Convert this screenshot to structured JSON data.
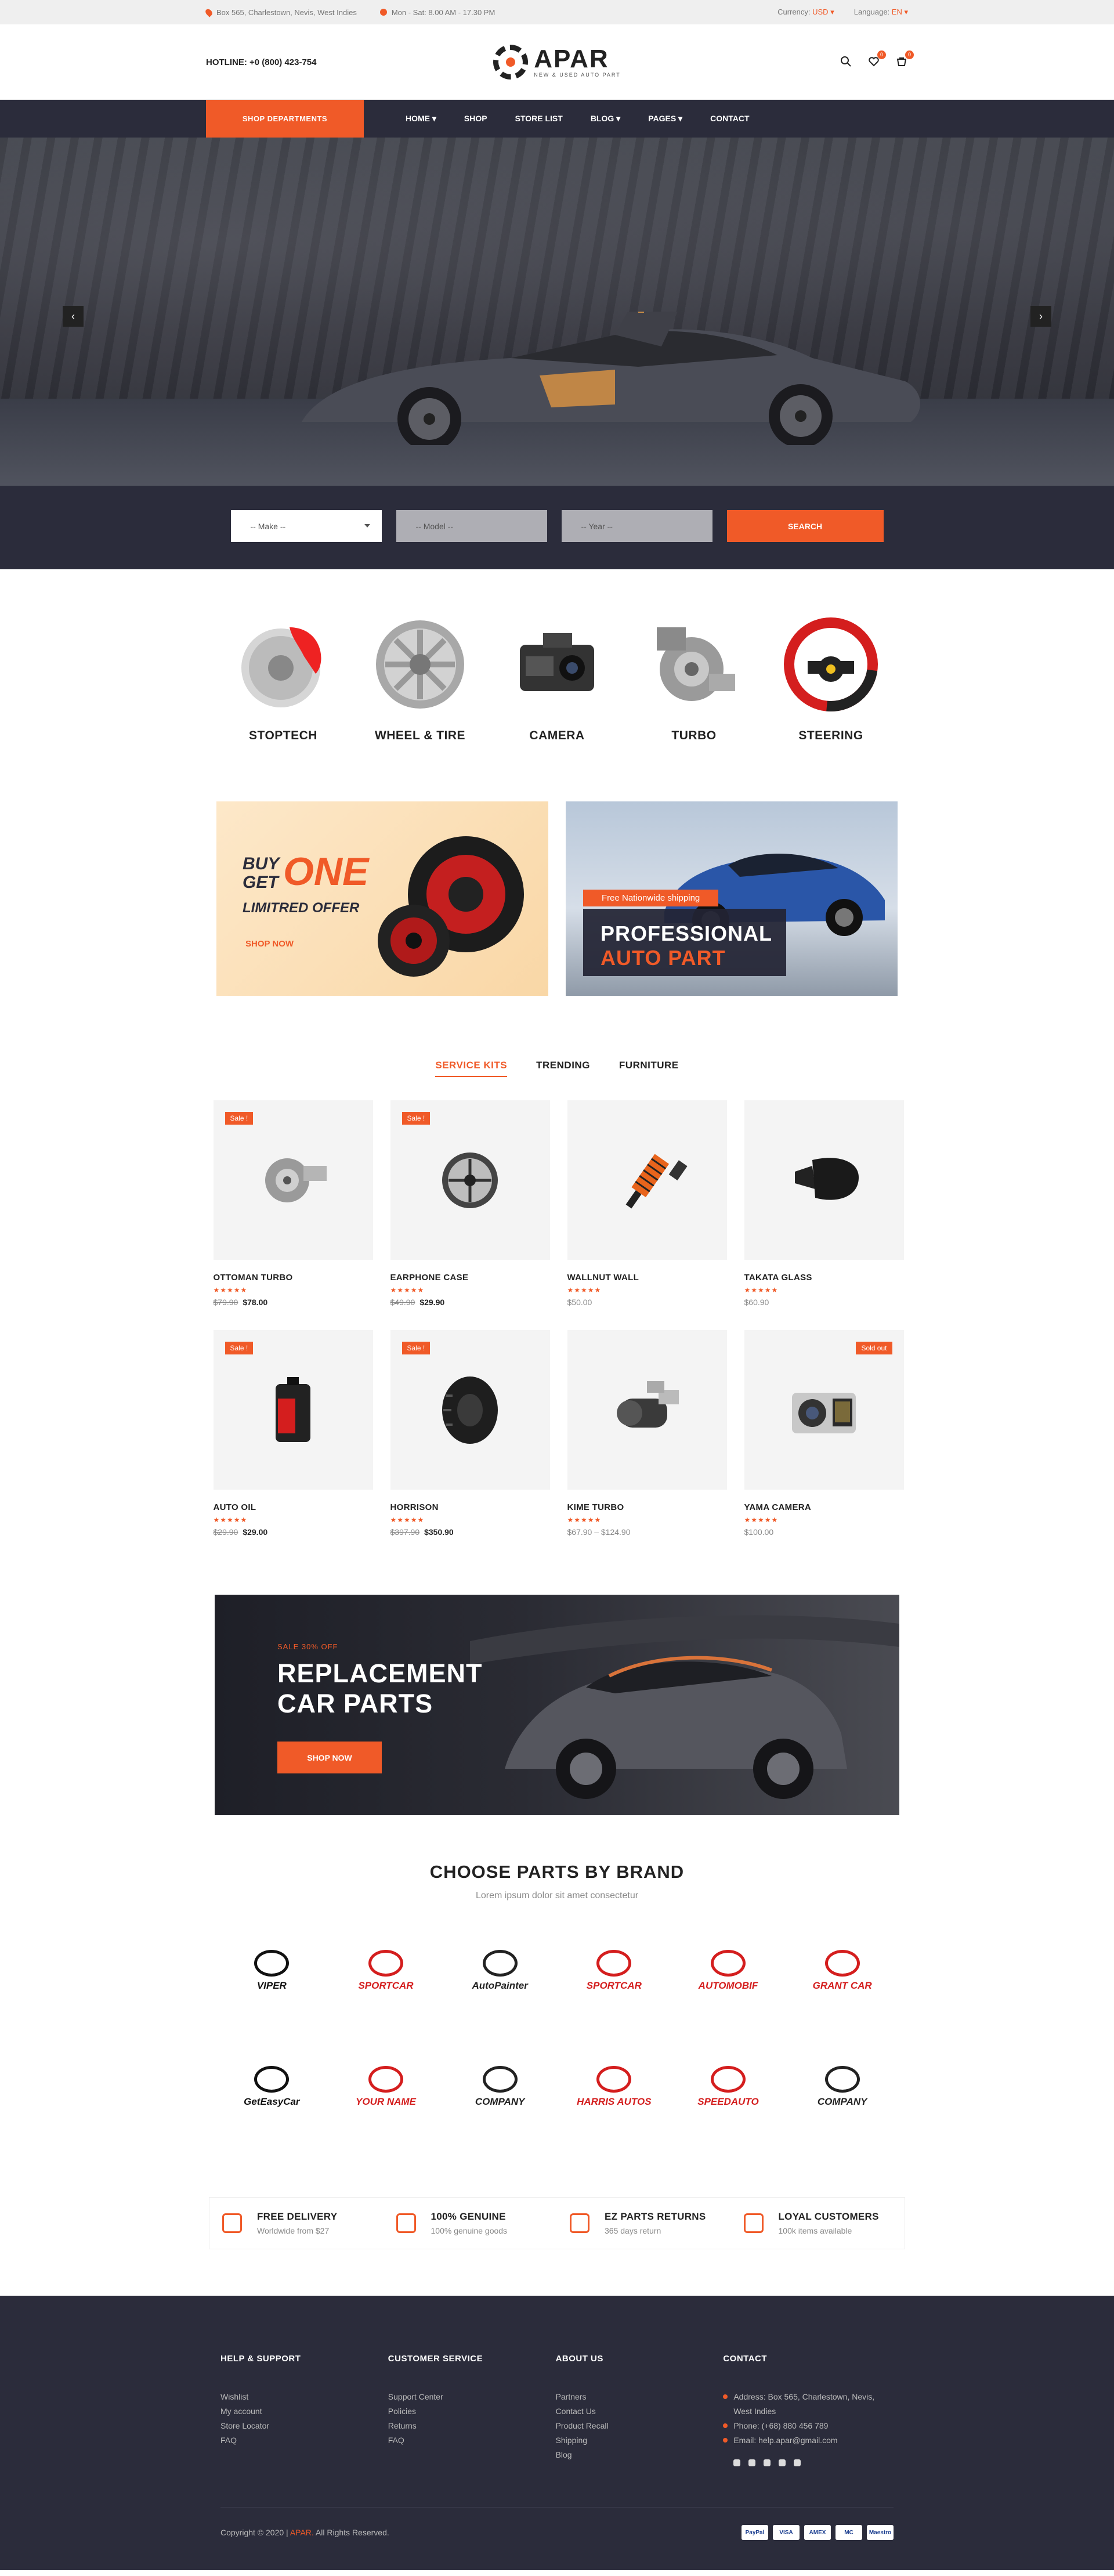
{
  "topbar": {
    "address": "Box 565, Charlestown, Nevis, West Indies",
    "hours": "Mon - Sat: 8.00 AM - 17.30 PM",
    "currency_label": "Currency:",
    "currency_value": "USD",
    "language_label": "Language:",
    "language_value": "EN"
  },
  "header": {
    "hotline": "HOTLINE: +0 (800) 423-754",
    "logo_name": "APAR",
    "logo_tagline": "NEW & USED AUTO PART",
    "wishlist_count": "0",
    "cart_count": "0"
  },
  "nav": {
    "shop_departments": "SHOP DEPARTMENTS",
    "items": [
      "HOME",
      "SHOP",
      "STORE LIST",
      "BLOG",
      "PAGES",
      "CONTACT"
    ],
    "dropdown_flags": [
      true,
      false,
      false,
      true,
      true,
      false
    ]
  },
  "search": {
    "make": "-- Make --",
    "model": "-- Model --",
    "year": "-- Year --",
    "button": "SEARCH"
  },
  "categories": [
    "STOPTECH",
    "WHEEL & TIRE",
    "CAMERA",
    "TURBO",
    "STEERING"
  ],
  "banner1": {
    "line1": "BUY",
    "line1b": "GET",
    "one": "ONE",
    "line2": "LIMITRED OFFER",
    "cta": "SHOP NOW"
  },
  "banner2": {
    "chip": "Free Nationwide shipping",
    "line1": "PROFESSIONAL",
    "line2": "AUTO PART"
  },
  "tabs": [
    "SERVICE KITS",
    "TRENDING",
    "FURNITURE"
  ],
  "products": [
    {
      "name": "OTTOMAN TURBO",
      "old": "$79.90",
      "new": "$78.00",
      "badge": "Sale !",
      "badge_side": "l",
      "icon": "turbo-icon"
    },
    {
      "name": "EARPHONE CASE",
      "old": "$49.90",
      "new": "$29.90",
      "badge": "Sale !",
      "badge_side": "l",
      "icon": "alternator-icon"
    },
    {
      "name": "WALLNUT WALL",
      "old": "",
      "new": "$50.00",
      "badge": "",
      "badge_side": "",
      "icon": "shock-absorber-icon"
    },
    {
      "name": "TAKATA GLASS",
      "old": "",
      "new": "$60.90",
      "badge": "",
      "badge_side": "",
      "icon": "mirror-icon"
    },
    {
      "name": "AUTO OIL",
      "old": "$29.90",
      "new": "$29.00",
      "badge": "Sale !",
      "badge_side": "l",
      "icon": "oil-can-icon"
    },
    {
      "name": "HORRISON",
      "old": "$397.90",
      "new": "$350.90",
      "badge": "Sale !",
      "badge_side": "l",
      "icon": "tire-icon"
    },
    {
      "name": "KIME TURBO",
      "old": "",
      "new": "$67.90 – $124.90",
      "badge": "",
      "badge_side": "",
      "icon": "compressor-icon"
    },
    {
      "name": "YAMA CAMERA",
      "old": "",
      "new": "$100.00",
      "badge": "Sold out",
      "badge_side": "r",
      "icon": "dashcam-icon"
    }
  ],
  "promo": {
    "sale": "SALE 30% OFF",
    "line1": "REPLACEMENT",
    "line2": "CAR PARTS",
    "button": "SHOP NOW"
  },
  "brands": {
    "title": "CHOOSE PARTS BY BRAND",
    "subtitle": "Lorem ipsum dolor sit amet consectetur",
    "logos": [
      "VIPER",
      "SPORTCAR",
      "AutoPainter",
      "SPORTCAR",
      "AUTOMOBIF",
      "GRANT CAR",
      "GetEasyCar",
      "YOUR NAME",
      "COMPANY",
      "HARRIS AUTOS",
      "SPEEDAUTO",
      "COMPANY"
    ]
  },
  "features": [
    {
      "title": "FREE DELIVERY",
      "sub": "Worldwide from $27",
      "icon": "truck-icon"
    },
    {
      "title": "100% GENUINE",
      "sub": "100% genuine goods",
      "icon": "shield-icon"
    },
    {
      "title": "EZ PARTS RETURNS",
      "sub": "365 days return",
      "icon": "return-box-icon"
    },
    {
      "title": "LOYAL CUSTOMERS",
      "sub": "100k items available",
      "icon": "gift-icon"
    }
  ],
  "footer": {
    "help": {
      "title": "HELP & SUPPORT",
      "links": [
        "Wishlist",
        "My account",
        "Store Locator",
        "FAQ"
      ]
    },
    "service": {
      "title": "CUSTOMER SERVICE",
      "links": [
        "Support Center",
        "Policies",
        "Returns",
        "FAQ"
      ]
    },
    "about": {
      "title": "ABOUT US",
      "links": [
        "Partners",
        "Contact Us",
        "Product Recall",
        "Shipping",
        "Blog"
      ]
    },
    "contact": {
      "title": "CONTACT",
      "address": "Address: Box 565, Charlestown, Nevis, West Indies",
      "phone": "Phone: (+68) 880 456 789",
      "email": "Email: help.apar@gmail.com"
    },
    "copyright_pre": "Copyright © 2020 |",
    "copyright_brand": "APAR.",
    "copyright_post": "All Rights Reserved.",
    "payments": [
      "PayPal",
      "VISA",
      "AMEX",
      "MC",
      "Maestro"
    ]
  },
  "colors": {
    "accent": "#f05a28",
    "dark": "#2b2c3b"
  }
}
